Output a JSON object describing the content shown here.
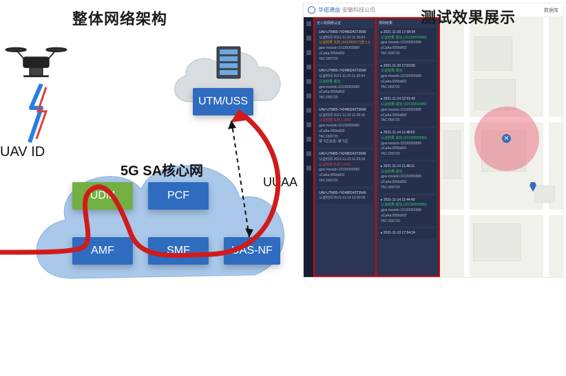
{
  "left": {
    "title": "整体网络架构",
    "utm_box": "UTM/USS",
    "uav_id": "UAV ID",
    "core_title": "5G SA核心网",
    "uuaa": "UUAA",
    "nf": {
      "udm": "UDM",
      "pcf": "PCF",
      "amf": "AMF",
      "smf": "SMF",
      "uasnf": "UAS-NF"
    }
  },
  "right": {
    "title": "测试效果展示",
    "topbar": {
      "brand": "华偌通益",
      "company": "安徽科技公司",
      "menu": "数据库"
    },
    "breadcrumb": "无人机网络认证",
    "col2_header": "规则结果",
    "col1": [
      {
        "id": "UAV-UTM05-742480242T3549",
        "time": "认证时间 2021-11-20 11:30:04",
        "result": "认证结果 失败 (441990017(登入))",
        "gpsi": "gpsi-msisdn-10130050589",
        "ucaa": "uCaAa:005fa802",
        "tac": "TAC:000720"
      },
      {
        "id": "UAV-UTM05-742480242T3549",
        "time": "认证时间 2021-11-20 11:30:04",
        "result": "认证结果 成功",
        "gpsi": "gpsi-msisdn-10130050589",
        "ucaa": "uCaAa:005fa802",
        "tac": "TAC:000720"
      },
      {
        "id": "UAV-UTM05-742480242T3549",
        "time": "认证时间 2021-11-20 11:29:18",
        "result": "认证结果 失败 (-250)",
        "gpsi": "gpsi-msisdn-10130050589",
        "ucaa": "uCaAa:005fa802",
        "tac": "TAC:000720",
        "extra": "禁飞区状态: 禁飞区"
      },
      {
        "id": "UAV-UTM05-742480242T3549",
        "time": "认证时间 2021-11-20 11:29:18",
        "result": "认证结果 失败 (-250)",
        "gpsi": "gpsi-msisdn-10130050589",
        "ucaa": "uCaAa:005fa802",
        "tac": "TAC:000720"
      },
      {
        "id": "UAV-UTM05-742480242T3549",
        "time": "认证时间 2021-11-14 12:30:04",
        "result": ""
      }
    ],
    "col2": [
      {
        "time": "2021-11-20 17:08:34",
        "result": "认证结果 成功 (10130050589)",
        "gpsi": "gpsi-msisdn-10130050589",
        "ucaa": "uCaAa:005fa802",
        "tac": "TAC:000720"
      },
      {
        "time": "2021-11-20 17:03:56",
        "result": "认证结果 成功",
        "gpsi": "gpsi-msisdn-10130050589",
        "ucaa": "uCaAa:005fa802",
        "tac": "TAC:000720"
      },
      {
        "time": "2021-11-14 12:01:42",
        "result": "认证结果 成功 (10130050589)",
        "gpsi": "gpsi-msisdn-10130050589",
        "ucaa": "uCaAa:005fa802",
        "tac": "TAC:000720"
      },
      {
        "time": "2021-11-14 11:48:52",
        "result": "认证结果 成功 (10130050589)",
        "gpsi": "gpsi-msisdn-10130050589",
        "ucaa": "uCaAa:005fa802",
        "tac": "TAC:000720"
      },
      {
        "time": "2021-11-14 11:48:11",
        "result": "认证结果 成功",
        "gpsi": "gpsi-msisdn-10130050589",
        "ucaa": "uCaAa:005fa802",
        "tac": "TAC:000720"
      },
      {
        "time": "2021-11-14 11:44:40",
        "result": "认证结果 成功 (10130050589)",
        "gpsi": "gpsi-msisdn-10130050589",
        "ucaa": "uCaAa:005fa802",
        "tac": "TAC:000720"
      },
      {
        "time": "2021-11-13 17:54:24",
        "result": ""
      }
    ]
  }
}
